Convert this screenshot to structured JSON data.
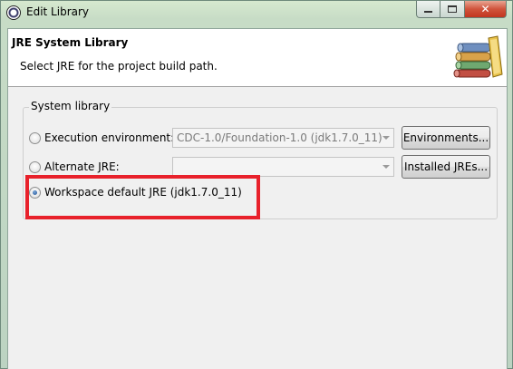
{
  "window": {
    "title": "Edit Library",
    "buttons": {
      "minimize": "minimize",
      "maximize": "maximize",
      "close": "✕"
    }
  },
  "banner": {
    "title": "JRE System Library",
    "description": "Select JRE for the project build path.",
    "icon": "library-books-icon"
  },
  "group": {
    "legend": "System library",
    "options": [
      {
        "label": "Execution environment:",
        "checked": false,
        "combo_value": "CDC-1.0/Foundation-1.0 (jdk1.7.0_11)",
        "button": "Environments..."
      },
      {
        "label": "Alternate JRE:",
        "checked": false,
        "combo_value": "",
        "button": "Installed JREs..."
      },
      {
        "label": "Workspace default JRE (jdk1.7.0_11)",
        "checked": true
      }
    ]
  },
  "colors": {
    "highlight": "#e8212b",
    "title_bar": "#c7dcc6"
  }
}
